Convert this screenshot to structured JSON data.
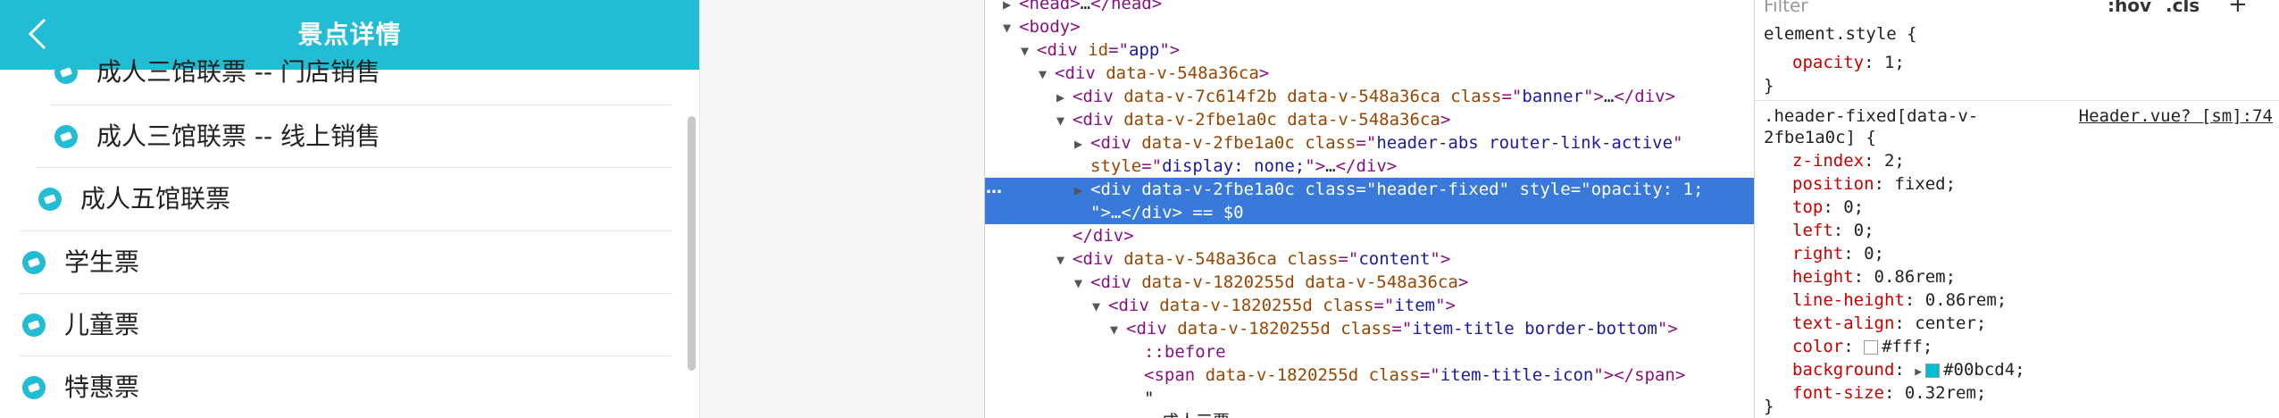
{
  "app": {
    "header_title": "景点详情",
    "header_color": "#22bcd4",
    "items": [
      {
        "label": "成人三馆联票 -- 门店销售"
      },
      {
        "label": "成人三馆联票 -- 线上销售"
      },
      {
        "label": "成人五馆联票"
      },
      {
        "label": "学生票"
      },
      {
        "label": "儿童票"
      },
      {
        "label": "特惠票"
      }
    ]
  },
  "elements": {
    "lines": [
      {
        "indent": 0,
        "arrow": "▶",
        "parts": [
          [
            "tag",
            "<head>"
          ],
          [
            "txt",
            "…"
          ],
          [
            "tag",
            "</head>"
          ]
        ]
      },
      {
        "indent": 0,
        "arrow": "▼",
        "parts": [
          [
            "tag",
            "<body>"
          ]
        ]
      },
      {
        "indent": 1,
        "arrow": "▼",
        "parts": [
          [
            "tag",
            "<div "
          ],
          [
            "attr",
            "id"
          ],
          [
            "punct",
            "=\""
          ],
          [
            "val",
            "app"
          ],
          [
            "punct",
            "\">"
          ]
        ]
      },
      {
        "indent": 2,
        "arrow": "▼",
        "parts": [
          [
            "tag",
            "<div "
          ],
          [
            "attr",
            "data-v-548a36ca"
          ],
          [
            "punct",
            ">"
          ]
        ]
      },
      {
        "indent": 3,
        "arrow": "▶",
        "parts": [
          [
            "tag",
            "<div "
          ],
          [
            "attr",
            "data-v-7c614f2b data-v-548a36ca class"
          ],
          [
            "punct",
            "=\""
          ],
          [
            "val",
            "banner"
          ],
          [
            "punct",
            "\">"
          ],
          [
            "txt",
            "…"
          ],
          [
            "tag",
            "</div>"
          ]
        ]
      },
      {
        "indent": 3,
        "arrow": "▼",
        "parts": [
          [
            "tag",
            "<div "
          ],
          [
            "attr",
            "data-v-2fbe1a0c data-v-548a36ca"
          ],
          [
            "punct",
            ">"
          ]
        ]
      },
      {
        "indent": 4,
        "arrow": "▶",
        "parts": [
          [
            "tag",
            "<div "
          ],
          [
            "attr",
            "data-v-2fbe1a0c class"
          ],
          [
            "punct",
            "=\""
          ],
          [
            "val",
            "header-abs router-link-active"
          ],
          [
            "punct",
            "\""
          ]
        ]
      },
      {
        "indent": 4,
        "arrow": "",
        "parts": [
          [
            "attr",
            "style"
          ],
          [
            "punct",
            "=\""
          ],
          [
            "val",
            "display: none;"
          ],
          [
            "punct",
            "\">"
          ],
          [
            "txt",
            "…"
          ],
          [
            "tag",
            "</div>"
          ]
        ]
      },
      {
        "indent": 4,
        "arrow": "▶",
        "selected": true,
        "parts": [
          [
            "tag",
            "<div "
          ],
          [
            "attr",
            "data-v-2fbe1a0c class"
          ],
          [
            "punct",
            "=\""
          ],
          [
            "val",
            "header-fixed"
          ],
          [
            "punct",
            "\" "
          ],
          [
            "attr",
            "style"
          ],
          [
            "punct",
            "=\""
          ],
          [
            "val",
            "opacity: 1;"
          ]
        ]
      },
      {
        "indent": 4,
        "arrow": "",
        "selected": true,
        "parts": [
          [
            "punct",
            "\">"
          ],
          [
            "txt",
            "…"
          ],
          [
            "tag",
            "</div>"
          ],
          [
            "txt",
            " == $0"
          ]
        ]
      },
      {
        "indent": 3,
        "arrow": "",
        "parts": [
          [
            "tag",
            "</div>"
          ]
        ]
      },
      {
        "indent": 3,
        "arrow": "▼",
        "parts": [
          [
            "tag",
            "<div "
          ],
          [
            "attr",
            "data-v-548a36ca class"
          ],
          [
            "punct",
            "=\""
          ],
          [
            "val",
            "content"
          ],
          [
            "punct",
            "\">"
          ]
        ]
      },
      {
        "indent": 4,
        "arrow": "▼",
        "parts": [
          [
            "tag",
            "<div "
          ],
          [
            "attr",
            "data-v-1820255d data-v-548a36ca"
          ],
          [
            "punct",
            ">"
          ]
        ]
      },
      {
        "indent": 5,
        "arrow": "▼",
        "parts": [
          [
            "tag",
            "<div "
          ],
          [
            "attr",
            "data-v-1820255d class"
          ],
          [
            "punct",
            "=\""
          ],
          [
            "val",
            "item"
          ],
          [
            "punct",
            "\">"
          ]
        ]
      },
      {
        "indent": 6,
        "arrow": "▼",
        "parts": [
          [
            "tag",
            "<div "
          ],
          [
            "attr",
            "data-v-1820255d class"
          ],
          [
            "punct",
            "=\""
          ],
          [
            "val",
            "item-title border-bottom"
          ],
          [
            "punct",
            "\">"
          ]
        ]
      },
      {
        "indent": 7,
        "arrow": "",
        "parts": [
          [
            "tag",
            "::before"
          ]
        ]
      },
      {
        "indent": 7,
        "arrow": "",
        "parts": [
          [
            "tag",
            "<span "
          ],
          [
            "attr",
            "data-v-1820255d class"
          ],
          [
            "punct",
            "=\""
          ],
          [
            "val",
            "item-title-icon"
          ],
          [
            "punct",
            "\">"
          ],
          [
            "tag",
            "</span>"
          ]
        ]
      },
      {
        "indent": 7,
        "arrow": "",
        "parts": [
          [
            "txt",
            "\""
          ]
        ]
      },
      {
        "indent": 8,
        "arrow": "",
        "parts": [
          [
            "txt",
            "成人三票"
          ]
        ]
      }
    ]
  },
  "styles": {
    "filter_placeholder": "Filter",
    "hov_label": ":hov",
    "cls_label": ".cls",
    "add_label": "+",
    "element_style_selector": "element.style {",
    "element_style_props": [
      {
        "name": "opacity",
        "value": "1;"
      }
    ],
    "rule_selector_line1": ".header-fixed[data-v-",
    "rule_selector_line2": "2fbe1a0c] {",
    "rule_source": "Header.vue? [sm]:74",
    "rule_props": [
      {
        "name": "z-index",
        "value": "2;"
      },
      {
        "name": "position",
        "value": "fixed;"
      },
      {
        "name": "top",
        "value": "0;"
      },
      {
        "name": "left",
        "value": "0;"
      },
      {
        "name": "right",
        "value": "0;"
      },
      {
        "name": "height",
        "value": "0.86rem;"
      },
      {
        "name": "line-height",
        "value": "0.86rem;"
      },
      {
        "name": "text-align",
        "value": "center;"
      },
      {
        "name": "color",
        "value": "#fff;",
        "swatch": "#ffffff"
      },
      {
        "name": "background",
        "value": "#00bcd4;",
        "swatch": "#00bcd4",
        "expand": true
      },
      {
        "name": "font-size",
        "value": "0.32rem;"
      }
    ],
    "close_brace": "}"
  }
}
